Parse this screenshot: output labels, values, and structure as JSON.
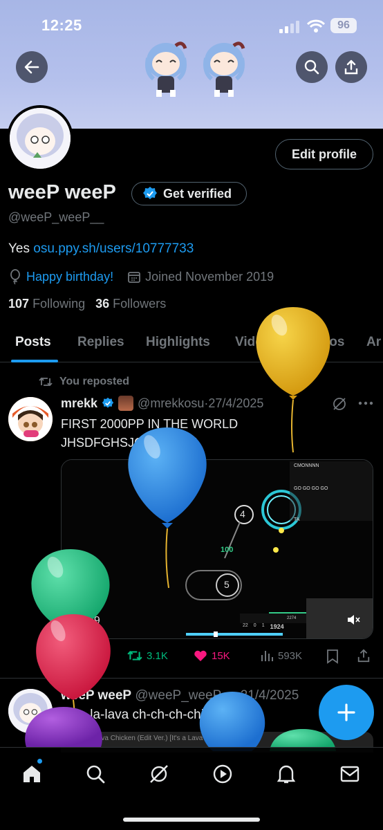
{
  "status_bar": {
    "time": "12:25",
    "battery": "96"
  },
  "profile": {
    "display_name": "weeP weeP",
    "get_verified_label": "Get verified",
    "handle": "@weeP_weeP__",
    "bio_prefix": "Yes",
    "bio_link": "osu.ppy.sh/users/10777733",
    "birthday_text": "Happy birthday!",
    "joined_text": "Joined November 2019",
    "following_count": "107",
    "following_label": "Following",
    "followers_count": "36",
    "followers_label": "Followers",
    "edit_profile_label": "Edit profile"
  },
  "tabs": [
    "Posts",
    "Replies",
    "Highlights",
    "Videos",
    "Photos",
    "Ar"
  ],
  "post1": {
    "repost_label": "You reposted",
    "author_name": "mrekk",
    "author_handle": "@mrekkosu",
    "date": "·27/4/2025",
    "text_line1": "FIRST 2000PP IN THE WORLD",
    "text_line2": "JHSDFGHSJGFKV SDK",
    "media": {
      "circle_a": "4",
      "circle_b": "5",
      "combo": "100",
      "hud_nums": [
        "22",
        "0",
        "1",
        "1924",
        "2274"
      ],
      "chat": [
        "CMONNNN",
        "GO GO GO GO",
        "TA"
      ]
    },
    "overlay_count": "39",
    "replies": "712",
    "reposts": "3.1K",
    "likes": "15K",
    "views": "593K"
  },
  "post2": {
    "author_name": "weeP weeP",
    "author_handle": "@weeP_weeP__",
    "date": "·21/4/2025",
    "text": "la-la-la-lava ch-ch-ch-chicken",
    "media_caption": "Steve's Lava Chicken (Edit Ver.) [It's a Lava Attack!]"
  },
  "colors": {
    "accent": "#1d9bf0",
    "repost_green": "#00ba7c",
    "like_pink": "#f91880"
  }
}
